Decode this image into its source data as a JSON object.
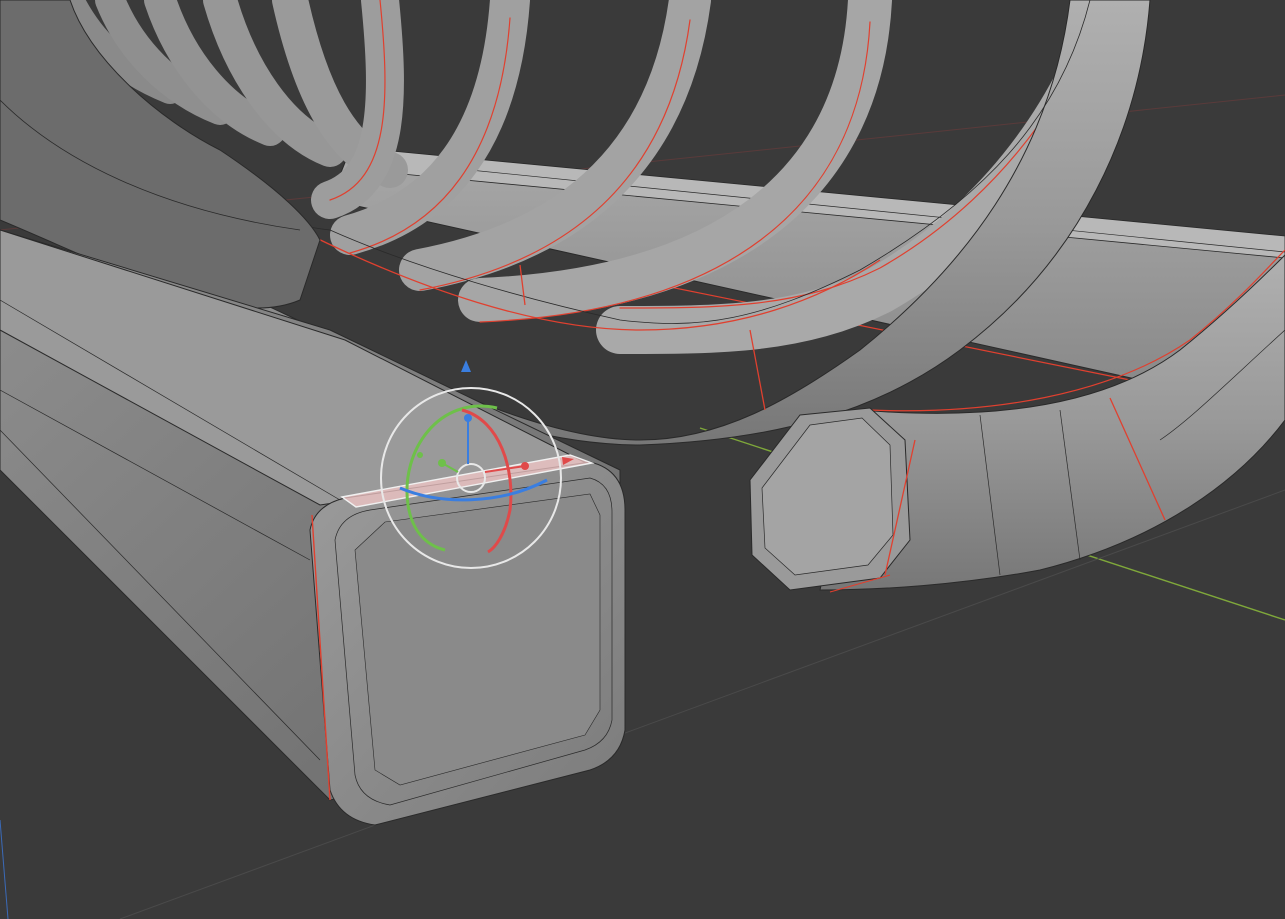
{
  "viewport": {
    "background": "#3a3a3a",
    "mesh_base_color": "#8e8e8e",
    "mesh_light_color": "#a9a9a9",
    "mesh_dark_color": "#5f5f5f",
    "wire_color": "#2a2a2a",
    "seam_color": "#e0402f",
    "axis_x_color": "#8a3a3a",
    "axis_y_color": "#7fa83a",
    "axis_z_color": "#3a6ab8",
    "grid_color": "#4a4a4a"
  },
  "gizmo": {
    "type": "rotate",
    "icons": {
      "x_handle": "x-rotate-handle-icon",
      "y_handle": "y-rotate-handle-icon",
      "z_handle": "z-rotate-handle-icon",
      "trackball": "trackball-ring-icon"
    },
    "x_color": "#e04a4a",
    "y_color": "#6ec04a",
    "z_color": "#3a7ee0",
    "ring_color": "#e8e8e8"
  },
  "selection": {
    "edge_loop_color": "#f0f0f0",
    "face_highlight": "#f3c7c7"
  }
}
